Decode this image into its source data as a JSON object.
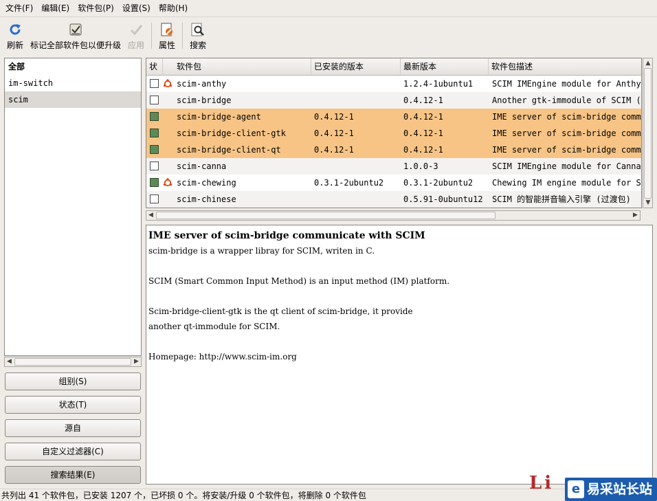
{
  "menubar": {
    "items": [
      "文件(F)",
      "编辑(E)",
      "软件包(P)",
      "设置(S)",
      "帮助(H)"
    ]
  },
  "toolbar": {
    "refresh": "刷新",
    "mark_all_upgrades": "标记全部软件包以便升级",
    "apply": "应用",
    "properties": "属性",
    "search": "搜索"
  },
  "filters": {
    "items": [
      "全部",
      "im-switch",
      "scim"
    ],
    "selected": "scim"
  },
  "side_buttons": {
    "sections": "组别(S)",
    "status": "状态(T)",
    "origin": "源自",
    "custom_filters": "自定义过滤器(C)",
    "search_results": "搜索结果(E)"
  },
  "table": {
    "columns": [
      "状",
      "软件包",
      "已安装的版本",
      "最新版本",
      "软件包描述"
    ],
    "rows": [
      {
        "name": "scim-anthy",
        "installed": "",
        "latest": "1.2.4-1ubuntu1",
        "desc": "SCIM IMEngine module for Anthy",
        "checked": false,
        "ubuntu": true,
        "highlight": false
      },
      {
        "name": "scim-bridge",
        "installed": "",
        "latest": "0.4.12-1",
        "desc": "Another gtk-immodule of SCIM (transi",
        "checked": false,
        "ubuntu": false,
        "highlight": false
      },
      {
        "name": "scim-bridge-agent",
        "installed": "0.4.12-1",
        "latest": "0.4.12-1",
        "desc": "IME server of scim-bridge communicat",
        "checked": true,
        "ubuntu": false,
        "highlight": true
      },
      {
        "name": "scim-bridge-client-gtk",
        "installed": "0.4.12-1",
        "latest": "0.4.12-1",
        "desc": "IME server of scim-bridge communicat",
        "checked": true,
        "ubuntu": false,
        "highlight": true
      },
      {
        "name": "scim-bridge-client-qt",
        "installed": "0.4.12-1",
        "latest": "0.4.12-1",
        "desc": "IME server of scim-bridge communicat",
        "checked": true,
        "ubuntu": false,
        "highlight": true
      },
      {
        "name": "scim-canna",
        "installed": "",
        "latest": "1.0.0-3",
        "desc": "SCIM IMEngine module for Canna",
        "checked": false,
        "ubuntu": false,
        "highlight": false
      },
      {
        "name": "scim-chewing",
        "installed": "0.3.1-2ubuntu2",
        "latest": "0.3.1-2ubuntu2",
        "desc": "Chewing IM engine module for SCIM",
        "checked": true,
        "ubuntu": true,
        "highlight": false
      },
      {
        "name": "scim-chinese",
        "installed": "",
        "latest": "0.5.91-0ubuntu12",
        "desc": "SCIM 的智能拼音输入引擎 (过渡包)",
        "checked": false,
        "ubuntu": false,
        "highlight": false
      }
    ]
  },
  "description": {
    "title": "IME server of scim-bridge communicate with SCIM",
    "lines": [
      "scim-bridge is a wrapper libray for SCIM, writen in C.",
      "",
      "SCIM (Smart Common Input Method) is an input method (IM) platform.",
      "",
      "Scim-bridge-client-gtk is the qt client of scim-bridge, it provide",
      "another qt-immodule for SCIM.",
      "",
      " Homepage: http://www.scim-im.org"
    ]
  },
  "statusbar": {
    "text": "共列出 41 个软件包，已安装 1207 个，已坏损 0 个。将安装/升级 0 个软件包，将删除 0 个软件包"
  },
  "watermark": {
    "text": "易采站长站"
  },
  "colors": {
    "highlight_row": "#f7c486",
    "checked_box": "#5e8a5a",
    "ubuntu_icon": "#dd4814",
    "refresh_icon": "#2a6cc8"
  }
}
